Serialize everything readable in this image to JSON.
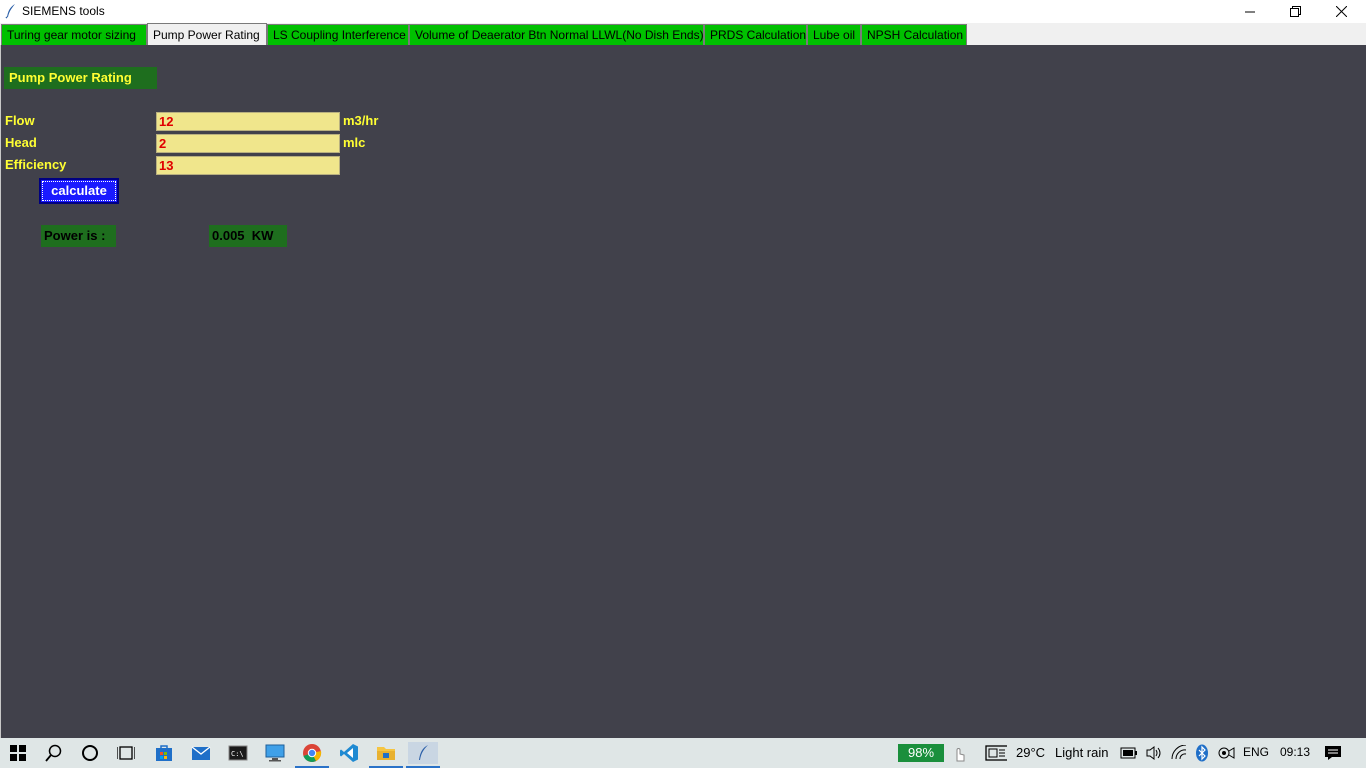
{
  "window": {
    "title": "SIEMENS tools",
    "minimize_icon": "minimize-icon",
    "maximize_icon": "restore-icon",
    "close_icon": "close-icon"
  },
  "tabs": [
    {
      "label": "Turing gear motor sizing",
      "active": false
    },
    {
      "label": "Pump Power Rating",
      "active": true
    },
    {
      "label": "LS Coupling Interference",
      "active": false
    },
    {
      "label": "Volume of Deaerator Btn Normal LLWL(No Dish Ends)",
      "active": false
    },
    {
      "label": "PRDS Calculation",
      "active": false
    },
    {
      "label": "Lube oil",
      "active": false
    },
    {
      "label": "NPSH Calculation",
      "active": false
    }
  ],
  "form": {
    "heading": "Pump Power Rating",
    "flow": {
      "label": "Flow",
      "value": "12",
      "unit": "m3/hr"
    },
    "head": {
      "label": "Head",
      "value": "2",
      "unit": "mlc"
    },
    "efficiency": {
      "label": "Efficiency",
      "value": "13"
    },
    "calculate_label": "calculate",
    "result_label": "Power is :",
    "result_value": "0.005  KW"
  },
  "taskbar": {
    "battery": "98%",
    "temperature": "29°C",
    "weather": "Light rain",
    "language": "ENG",
    "time": "09:13"
  },
  "colors": {
    "content_bg": "#41414b",
    "tab_green": "#00c000",
    "label_yellow": "#ffff33",
    "field_bg": "#f0e68c",
    "value_red": "#e00000",
    "button_blue": "#1a1aff",
    "dark_green": "#1e6e1e"
  }
}
